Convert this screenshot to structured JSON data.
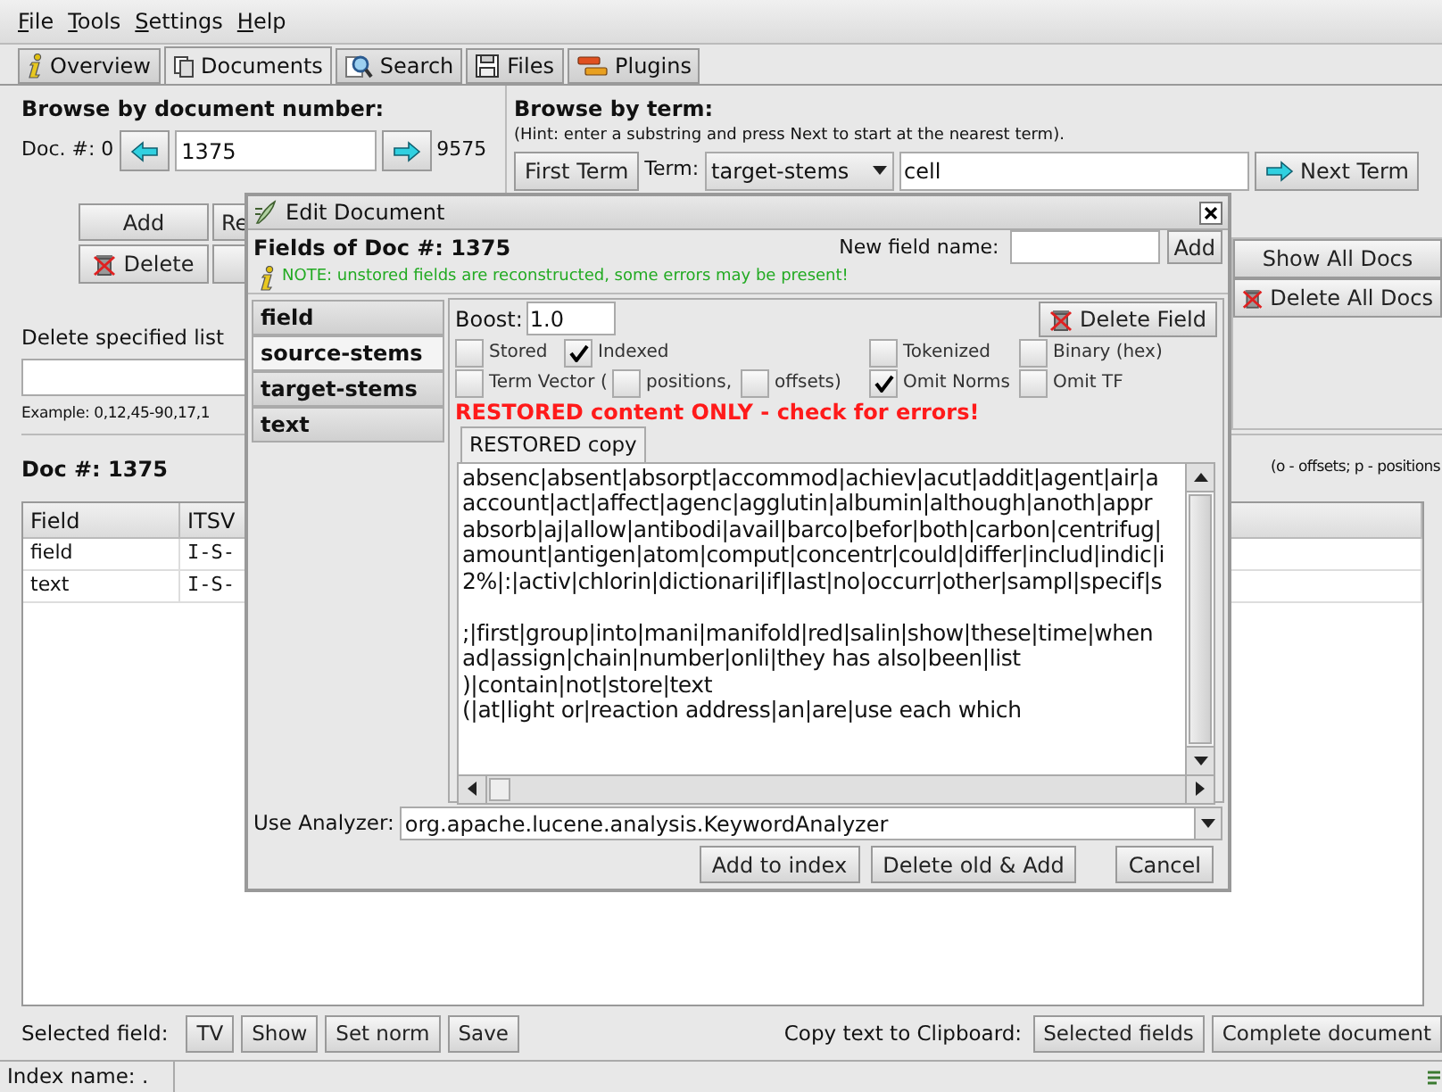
{
  "menu": [
    {
      "label": "File"
    },
    {
      "label": "Tools"
    },
    {
      "label": "Settings"
    },
    {
      "label": "Help"
    }
  ],
  "tabs": [
    {
      "label": "Overview",
      "kind": "info",
      "selected": false
    },
    {
      "label": "Documents",
      "kind": "documents",
      "selected": true
    },
    {
      "label": "Search",
      "kind": "search",
      "selected": false
    },
    {
      "label": "Files",
      "kind": "files",
      "selected": false
    },
    {
      "label": "Plugins",
      "kind": "plugins",
      "selected": false
    }
  ],
  "browse_doc": {
    "title": "Browse by document number:",
    "min_label": "Doc. #: 0",
    "doc_number": "1375",
    "max": "9575"
  },
  "browse_term": {
    "title": "Browse by term:",
    "hint": "(Hint: enter a substring and press Next to start at the nearest term).",
    "first_button": "First Term",
    "term_label": "Term:",
    "field": "target-stems",
    "term": "cell",
    "next_button": "Next Term"
  },
  "doc_buttons": {
    "add": "Add",
    "replace": "Re",
    "delete": "Delete"
  },
  "delete_list": {
    "label": "Delete specified list",
    "example": "Example: 0,12,45-90,17,1"
  },
  "right_buttons": {
    "show_all": "Show All Docs",
    "delete_all": "Delete All Docs"
  },
  "doc_heading": "Doc #: 1375",
  "legend": "(o - offsets; p - positions",
  "table": {
    "columns": [
      "Field",
      "ITSV"
    ],
    "rows": [
      [
        "field",
        "I-S-"
      ],
      [
        "text",
        "I-S-"
      ]
    ]
  },
  "bottom": {
    "selected_label": "Selected field:",
    "buttons": [
      "TV",
      "Show",
      "Set norm",
      "Save"
    ],
    "copy_label": "Copy text to Clipboard:",
    "copy_buttons": [
      "Selected fields",
      "Complete document"
    ]
  },
  "status_bar": {
    "index_name": "Index name: ."
  },
  "dialog": {
    "title": "Edit Document",
    "heading": "Fields of Doc #: 1375",
    "new_field_label": "New field name:",
    "add_button": "Add",
    "note": "NOTE: unstored fields are reconstructed, some errors may be present!",
    "fields": [
      {
        "label": "field",
        "selected": false
      },
      {
        "label": "source-stems",
        "selected": true
      },
      {
        "label": "target-stems",
        "selected": false
      },
      {
        "label": "text",
        "selected": false
      }
    ],
    "boost_label": "Boost:",
    "boost": "1.0",
    "delete_field": "Delete Field",
    "checkbox_rows": [
      [
        {
          "label": "Stored",
          "checked": false
        },
        {
          "label": "Indexed",
          "checked": true
        },
        {
          "label": "Tokenized",
          "checked": false
        },
        {
          "label": "Binary (hex)",
          "checked": false
        }
      ],
      [
        {
          "label": "Term Vector (",
          "checked": false
        },
        {
          "label": "positions,",
          "checked": false
        },
        {
          "label": "offsets)",
          "checked": false
        },
        {
          "label": "Omit Norms",
          "checked": true
        },
        {
          "label": "Omit TF",
          "checked": false
        }
      ]
    ],
    "warning": "RESTORED content ONLY - check for errors!",
    "content_tab": "RESTORED copy",
    "content_paragraphs": [
      [
        "absenc|absent|absorpt|accommod|achiev|acut|addit|agent|air|a",
        "account|act|affect|agenc|agglutin|albumin|although|anoth|appr",
        "absorb|aj|allow|antibodi|avail|barco|befor|both|carbon|centrifug|",
        "amount|antigen|atom|comput|concentr|could|differ|includ|indic|i",
        "2%|:|activ|chlorin|dictionari|if|last|no|occurr|other|sampl|specif|s"
      ],
      [
        ";|first|group|into|mani|manifold|red|salin|show|these|time|when",
        "ad|assign|chain|number|onli|they has also|been|list",
        ")|contain|not|store|text",
        "(|at|light or|reaction address|an|are|use each which"
      ]
    ],
    "analyzer_label": "Use Analyzer:",
    "analyzer": "org.apache.lucene.analysis.KeywordAnalyzer",
    "buttons": [
      "Add to index",
      "Delete old & Add",
      "Cancel"
    ]
  }
}
